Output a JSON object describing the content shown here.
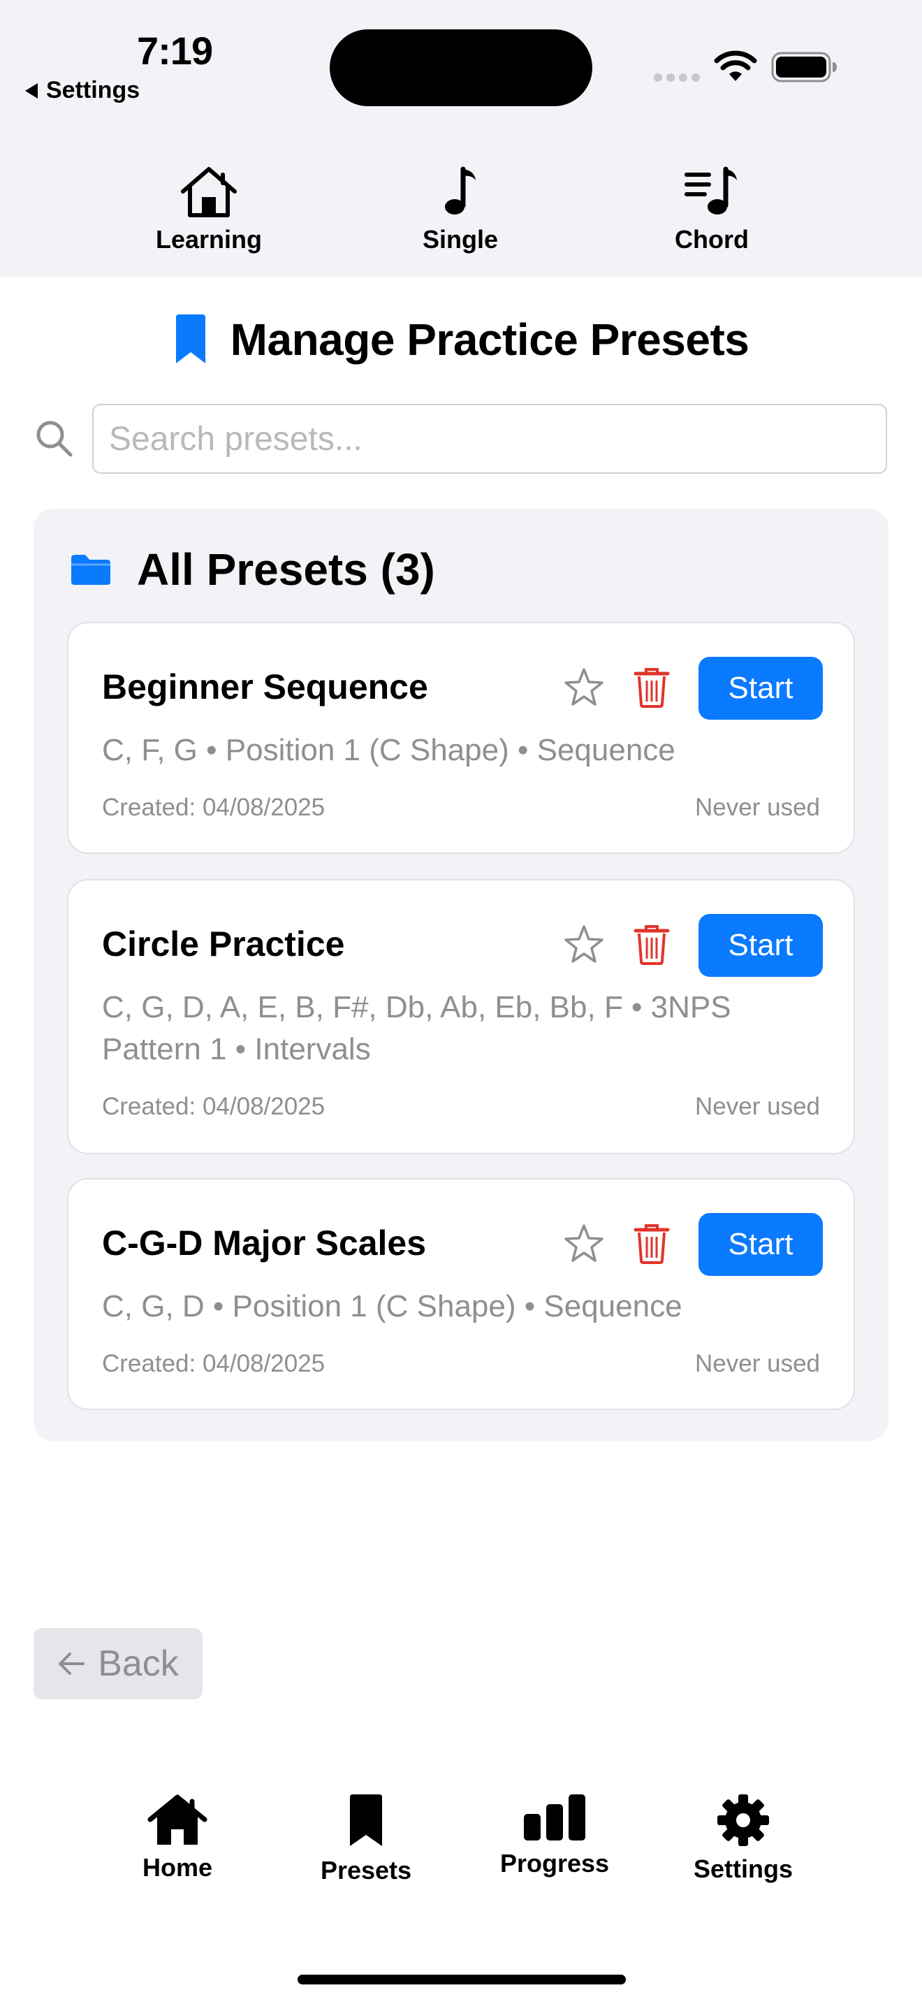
{
  "status_bar": {
    "time": "7:19",
    "back_app": "Settings"
  },
  "top_tabs": [
    {
      "label": "Learning",
      "icon": "house-icon"
    },
    {
      "label": "Single",
      "icon": "music-note-icon"
    },
    {
      "label": "Chord",
      "icon": "music-note-list-icon"
    }
  ],
  "page": {
    "title": "Manage Practice Presets",
    "title_icon": "bookmark-icon"
  },
  "search": {
    "placeholder": "Search presets...",
    "value": ""
  },
  "group": {
    "title": "All Presets (3)",
    "icon": "folder-icon"
  },
  "presets": [
    {
      "name": "Beginner Sequence",
      "description": "C, F, G • Position 1 (C Shape) • Sequence",
      "created": "Created: 04/08/2025",
      "last_used": "Never used",
      "start_label": "Start"
    },
    {
      "name": "Circle Practice",
      "description": "C, G, D, A, E, B, F#, Db, Ab, Eb, Bb, F • 3NPS Pattern 1 • Intervals",
      "created": "Created: 04/08/2025",
      "last_used": "Never used",
      "start_label": "Start"
    },
    {
      "name": "C-G-D Major Scales",
      "description": "C, G, D • Position 1 (C Shape) • Sequence",
      "created": "Created: 04/08/2025",
      "last_used": "Never used",
      "start_label": "Start"
    }
  ],
  "back_button": {
    "label": "Back"
  },
  "bottom_tabs": [
    {
      "label": "Home",
      "icon": "house-fill-icon"
    },
    {
      "label": "Presets",
      "icon": "bookmark-fill-icon"
    },
    {
      "label": "Progress",
      "icon": "chart-bar-icon"
    },
    {
      "label": "Settings",
      "icon": "gear-icon"
    }
  ],
  "colors": {
    "accent": "#0a7aff",
    "destructive": "#e0342b",
    "secondary_text": "#8e8e93",
    "group_background": "#f2f2f7"
  }
}
